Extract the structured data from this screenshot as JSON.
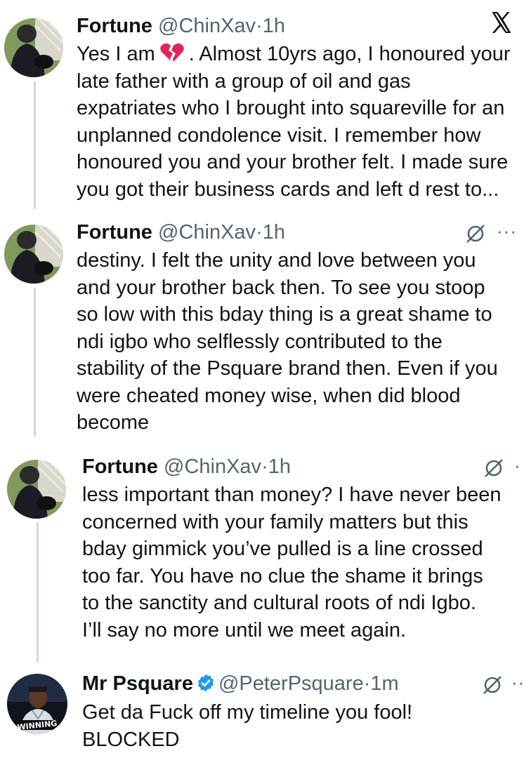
{
  "app": {
    "logo_icon": "x-logo-icon"
  },
  "colors": {
    "text": "#0f1419",
    "secondary": "#536471",
    "thread_line": "#cfd9de",
    "verified": "#1d9bf0",
    "heart": "#e0245e"
  },
  "tweets": [
    {
      "name": "Fortune",
      "handle": "@ChinXav",
      "dot": "·",
      "time": "1h",
      "lines": [
        {
          "a": "Yes I am",
          "b": ". Almost 10yrs ago, I honoured your"
        },
        "late father with a group of oil and gas",
        "expatriates who I brought into squareville for an",
        "unplanned condolence visit. I remember how",
        "honoured you and your brother felt. I made sure",
        "you got their business cards and left d rest to..."
      ]
    },
    {
      "name": "Fortune",
      "handle": "@ChinXav",
      "dot": "·",
      "time": "1h",
      "more": "···",
      "lines": [
        "destiny. I felt the unity and love between you",
        "and your brother back then. To see you stoop",
        "so low with this bday thing is a great shame to",
        "ndi igbo who selflessly contributed to the",
        "stability of the Psquare brand then. Even if you",
        "were cheated money wise, when did blood",
        "become"
      ]
    },
    {
      "name": "Fortune",
      "handle": "@ChinXav",
      "dot": "·",
      "time": "1h",
      "more": "·",
      "lines": [
        "less important than money? I have never been",
        "concerned with your family matters but this",
        "bday gimmick you’ve pulled is a line crossed",
        "too far. You have no clue the shame it brings",
        "to the sanctity and cultural roots of ndi Igbo.",
        "I’ll say no more until we meet again."
      ]
    },
    {
      "name": "Mr Psquare",
      "handle": "@PeterPsquare",
      "dot": "·",
      "time": "1m",
      "more": "··",
      "avatar_text": "WINNING",
      "lines": [
        "Get da Fuck off my timeline you fool!",
        "BLOCKED"
      ]
    }
  ]
}
